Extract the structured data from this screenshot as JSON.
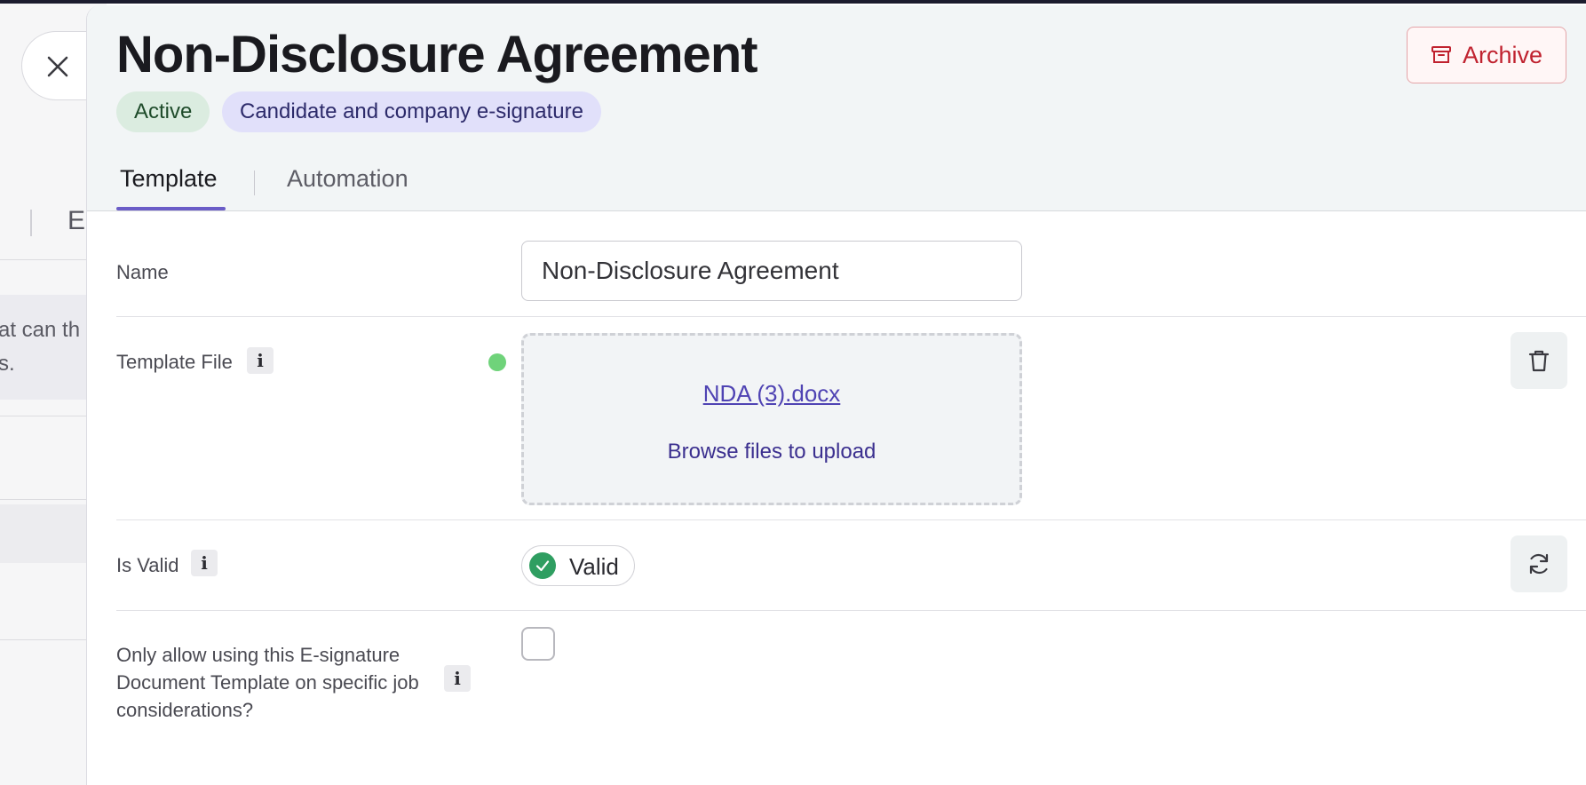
{
  "background": {
    "tab_partial": "E",
    "note_line1": "at can th",
    "note_line2": "s."
  },
  "drawer": {
    "title": "Non-Disclosure Agreement",
    "badges": {
      "status": "Active",
      "signature_type": "Candidate and company e-signature"
    },
    "archive_label": "Archive",
    "tabs": {
      "template": "Template",
      "automation": "Automation"
    }
  },
  "form": {
    "name": {
      "label": "Name",
      "value": "Non-Disclosure Agreement"
    },
    "template_file": {
      "label": "Template File",
      "file_name": "NDA (3).docx",
      "browse_label": "Browse files to upload"
    },
    "is_valid": {
      "label": "Is Valid",
      "status": "Valid"
    },
    "job_restriction": {
      "label": "Only allow using this E-signature Document Template on specific job considerations?",
      "checked": false
    },
    "info_glyph": "i"
  },
  "colors": {
    "accent": "#6a5cc7",
    "archive": "#c0222f",
    "valid": "#2f9e61",
    "status_dot": "#6fd37a"
  },
  "icons": [
    "close-icon",
    "archive-icon",
    "trash-icon",
    "refresh-icon",
    "check-icon",
    "info-icon"
  ]
}
